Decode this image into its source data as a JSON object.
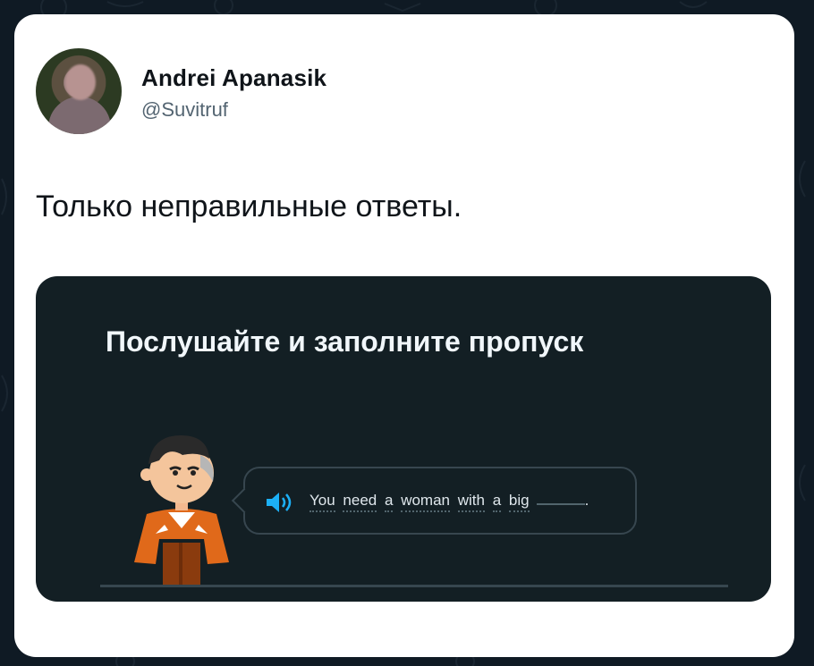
{
  "tweet": {
    "author_name": "Andrei Apanasik",
    "author_handle": "@Suvitruf",
    "text": "Только неправильные ответы."
  },
  "embedded_screen": {
    "title": "Послушайте и заполните пропуск",
    "sentence_words": [
      "You",
      "need",
      "a",
      "woman",
      "with",
      "a",
      "big"
    ],
    "punctuation": ".",
    "icon": "speaker-icon"
  },
  "colors": {
    "page_bg": "#0f1a24",
    "card_bg": "#ffffff",
    "media_bg": "#131f24",
    "accent_blue": "#1cb0f6",
    "character_orange": "#e0691a"
  }
}
